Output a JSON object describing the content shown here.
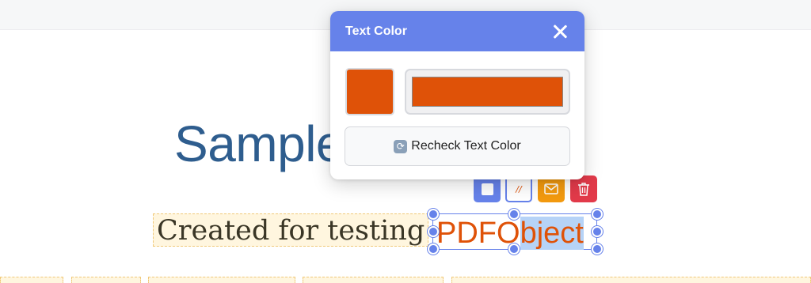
{
  "document": {
    "title": "Sample",
    "subtitle_text": "Created for testing",
    "pdf_object_text_plain": "PDFO",
    "pdf_object_text_selected": "bject"
  },
  "modal": {
    "title": "Text Color",
    "color_value": "#df5208",
    "recheck_label": "Recheck Text Color"
  },
  "toolbar": {
    "color_glyph": "//"
  },
  "colors": {
    "accent": "#6682ea",
    "text_color": "#df5208",
    "title_blue": "#2e5d8e",
    "mail_orange": "#f39a0f",
    "delete_red": "#e23a4a"
  }
}
